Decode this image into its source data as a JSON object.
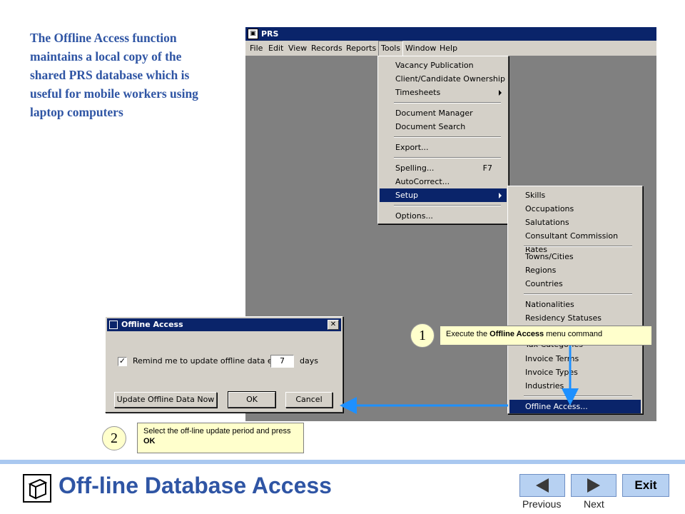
{
  "intro_text": "The Offline Access function maintains a local copy of the shared PRS database which is useful for mobile workers using laptop computers",
  "app": {
    "title": "PRS",
    "menus": [
      "File",
      "Edit",
      "View",
      "Records",
      "Reports",
      "Tools",
      "Window",
      "Help"
    ]
  },
  "tools_menu": {
    "items": [
      "Vacancy Publication",
      "Client/Candidate Ownership",
      "Timesheets",
      "Document Manager",
      "Document Search",
      "Export...",
      "Spelling...",
      "AutoCorrect...",
      "Setup",
      "Options..."
    ],
    "spelling_shortcut": "F7"
  },
  "setup_menu": {
    "items": [
      "Skills",
      "Occupations",
      "Salutations",
      "Consultant Commission Rates",
      "Towns/Cities",
      "Regions",
      "Countries",
      "Nationalities",
      "Residency Statuses",
      "Tax Categories",
      "Invoice Terms",
      "Invoice Types",
      "Industries",
      "Offline Access..."
    ]
  },
  "dialog": {
    "title": "Offline Access",
    "remind_label": "Remind me to update offline data every",
    "days_value": "7",
    "days_label": "days",
    "update_button": "Update Offline Data Now",
    "ok_button": "OK",
    "cancel_button": "Cancel"
  },
  "callouts": {
    "step1_number": "1",
    "step1_prefix": "Execute the ",
    "step1_bold": "Offline Access",
    "step1_suffix": " menu command",
    "step2_number": "2",
    "step2_text": "Select the off-line update period and press ",
    "step2_bold": "OK"
  },
  "footer": {
    "title": "Off-line Database Access",
    "previous": "Previous",
    "next": "Next",
    "exit": "Exit"
  }
}
